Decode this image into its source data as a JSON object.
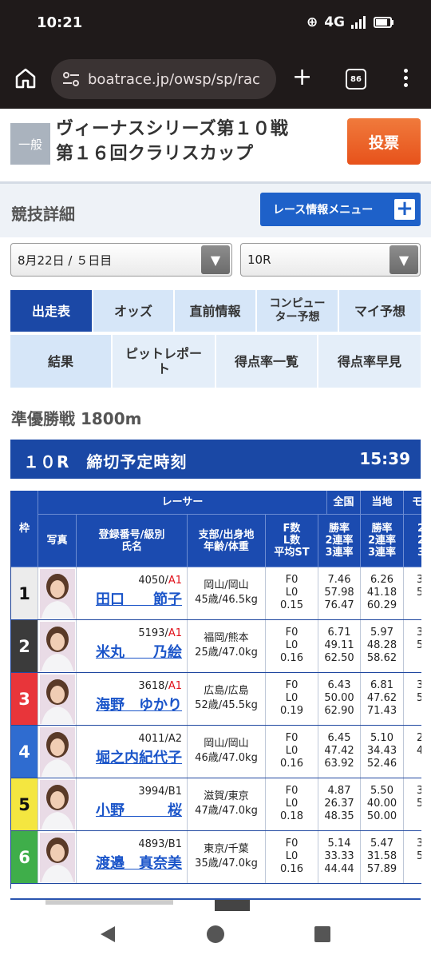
{
  "status": {
    "time": "10:21",
    "network": "4G"
  },
  "browser": {
    "url": "boatrace.jp/owsp/sp/rac",
    "tab_count": "86"
  },
  "race": {
    "grade": "一般",
    "title_line1": "ヴィーナスシリーズ第１０戦",
    "title_line2": "第１６回クラリスカップ",
    "vote_label": "投票"
  },
  "detail": {
    "title": "競技詳細",
    "menu_label": "レース情報メニュー"
  },
  "selects": {
    "date": "8月22日 / ５日目",
    "race": "10R"
  },
  "tabs": {
    "row1": [
      "出走表",
      "オッズ",
      "直前情報",
      "コンピュー\nター予想",
      "マイ予想"
    ],
    "row2": [
      "結果",
      "ピットレポー\nト",
      "得点率一覧",
      "得点率早見"
    ]
  },
  "race_info": {
    "subtitle": "準優勝戦 1800m",
    "deadline_label": "１０R　締切予定時刻",
    "deadline_time": "15:39"
  },
  "table": {
    "headers": {
      "frame": "枠",
      "racer": "レーサー",
      "national": "全国",
      "local": "当地",
      "motor": "モ",
      "photo": "写真",
      "reg_class": "登録番号/級別\n氏名",
      "branch": "支部/出身地\n年齢/体重",
      "f_l_st": "F数\nL数\n平均ST",
      "rates": "勝率\n2連率\n3連率"
    },
    "rows": [
      {
        "frame": "1",
        "reg": "4050/",
        "cls": "A1",
        "name": "田口　　節子",
        "branch": "岡山/岡山",
        "age_weight": "45歳/46.5kg",
        "f": "F0",
        "l": "L0",
        "st": "0.15",
        "nat": [
          "7.46",
          "57.98",
          "76.47"
        ],
        "loc": [
          "6.26",
          "41.18",
          "60.29"
        ],
        "mot": [
          "3",
          "5",
          ""
        ]
      },
      {
        "frame": "2",
        "reg": "5193/",
        "cls": "A1",
        "name": "米丸　　乃絵",
        "branch": "福岡/熊本",
        "age_weight": "25歳/47.0kg",
        "f": "F0",
        "l": "L0",
        "st": "0.16",
        "nat": [
          "6.71",
          "49.11",
          "62.50"
        ],
        "loc": [
          "5.97",
          "48.28",
          "58.62"
        ],
        "mot": [
          "3",
          "5",
          ""
        ]
      },
      {
        "frame": "3",
        "reg": "3618/",
        "cls": "A1",
        "name": "海野　ゆかり",
        "branch": "広島/広島",
        "age_weight": "52歳/45.5kg",
        "f": "F0",
        "l": "L0",
        "st": "0.19",
        "nat": [
          "6.43",
          "50.00",
          "62.90"
        ],
        "loc": [
          "6.81",
          "47.62",
          "71.43"
        ],
        "mot": [
          "3",
          "5",
          ""
        ]
      },
      {
        "frame": "4",
        "reg": "4011/",
        "cls": "A2",
        "name": "堀之内紀代子",
        "branch": "岡山/岡山",
        "age_weight": "46歳/47.0kg",
        "f": "F0",
        "l": "L0",
        "st": "0.16",
        "nat": [
          "6.45",
          "47.42",
          "63.92"
        ],
        "loc": [
          "5.10",
          "34.43",
          "52.46"
        ],
        "mot": [
          "2",
          "4",
          ""
        ]
      },
      {
        "frame": "5",
        "reg": "3994/",
        "cls": "B1",
        "name": "小野　　　桜",
        "branch": "滋賀/東京",
        "age_weight": "47歳/47.0kg",
        "f": "F0",
        "l": "L0",
        "st": "0.18",
        "nat": [
          "4.87",
          "26.37",
          "48.35"
        ],
        "loc": [
          "5.50",
          "40.00",
          "50.00"
        ],
        "mot": [
          "3",
          "5",
          ""
        ]
      },
      {
        "frame": "6",
        "reg": "4893/",
        "cls": "B1",
        "name": "渡邉　真奈美",
        "branch": "東京/千葉",
        "age_weight": "35歳/47.0kg",
        "f": "F0",
        "l": "L0",
        "st": "0.16",
        "nat": [
          "5.14",
          "33.33",
          "44.44"
        ],
        "loc": [
          "5.47",
          "31.58",
          "57.89"
        ],
        "mot": [
          "3",
          "5",
          ""
        ]
      }
    ]
  },
  "colors": {
    "frame_colors": [
      "#ececec",
      "#3b3b3b",
      "#e8353a",
      "#2f6cd0",
      "#f4e640",
      "#3fae4a"
    ],
    "frame_text": [
      "#111",
      "#fff",
      "#fff",
      "#fff",
      "#111",
      "#fff"
    ],
    "accent_blue": "#1b48a6",
    "vote_orange": "#e95e22"
  },
  "icons": {
    "home": "home-icon",
    "tune": "tune-icon",
    "plus": "plus-icon",
    "tabs": "tabs-icon",
    "more": "more-vert-icon",
    "dropdown": "chevron-down-icon",
    "back": "back-triangle-icon",
    "home_nav": "home-circle-icon",
    "recents": "recents-square-icon"
  }
}
